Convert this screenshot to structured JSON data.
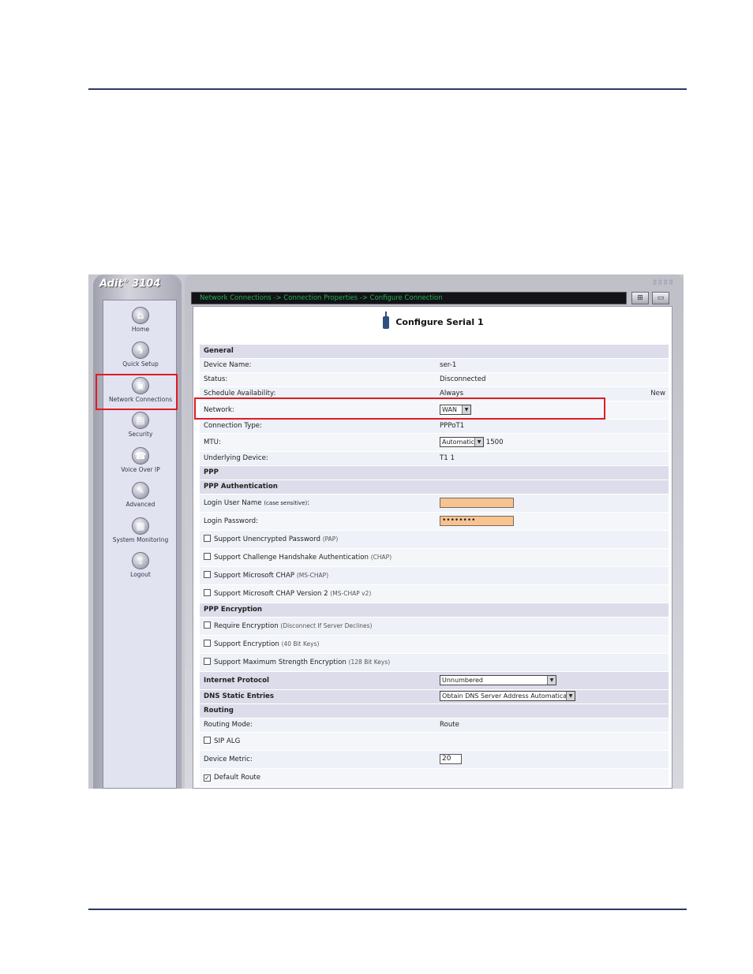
{
  "app": {
    "logo": "Adit",
    "logo_reg": "®",
    "logo_model": " 3104"
  },
  "breadcrumb": "Network Connections -> Connection Properties -> Configure Connection",
  "nav": [
    {
      "label": "Home",
      "icon": "home-icon"
    },
    {
      "label": "Quick Setup",
      "icon": "lightning-icon"
    },
    {
      "label": "Network Connections",
      "icon": "network-icon"
    },
    {
      "label": "Security",
      "icon": "lock-icon"
    },
    {
      "label": "Voice Over IP",
      "icon": "phone-icon"
    },
    {
      "label": "Advanced",
      "icon": "tools-icon"
    },
    {
      "label": "System Monitoring",
      "icon": "monitor-icon"
    },
    {
      "label": "Logout",
      "icon": "logout-icon"
    }
  ],
  "page": {
    "title": "Configure Serial 1"
  },
  "general": {
    "header": "General",
    "device_name_label": "Device Name:",
    "device_name": "ser-1",
    "status_label": "Status:",
    "status": "Disconnected",
    "schedule_label": "Schedule Availability:",
    "schedule": "Always",
    "schedule_new": "New",
    "network_label": "Network:",
    "network": "WAN",
    "conn_type_label": "Connection Type:",
    "conn_type": "PPPoT1",
    "mtu_label": "MTU:",
    "mtu_mode": "Automatic",
    "mtu_value": "1500",
    "underlying_label": "Underlying Device:",
    "underlying": "T1 1"
  },
  "ppp": {
    "header": "PPP",
    "auth_header": "PPP Authentication",
    "login_user_label": "Login User Name",
    "login_user_hint": "(case sensitive)",
    "login_user_colon": ":",
    "login_user_value": "",
    "login_pass_label": "Login Password:",
    "login_pass_value": "••••••••",
    "pap_label": "Support Unencrypted Password",
    "pap_hint": "(PAP)",
    "chap_label": "Support Challenge Handshake Authentication",
    "chap_hint": "(CHAP)",
    "mschap_label": "Support Microsoft CHAP",
    "mschap_hint": "(MS-CHAP)",
    "mschap2_label": "Support Microsoft CHAP Version 2",
    "mschap2_hint": "(MS-CHAP v2)",
    "enc_header": "PPP Encryption",
    "req_enc_label": "Require Encryption",
    "req_enc_hint": "(Disconnect If Server Declines)",
    "sup_enc_label": "Support Encryption",
    "sup_enc_hint": "(40 Bit Keys)",
    "max_enc_label": "Support Maximum Strength Encryption",
    "max_enc_hint": "(128 Bit Keys)"
  },
  "ip": {
    "internet_protocol_label": "Internet Protocol",
    "internet_protocol": "Unnumbered",
    "dns_label": "DNS Static Entries",
    "dns": "Obtain DNS Server Address Automatically"
  },
  "routing": {
    "header": "Routing",
    "mode_label": "Routing Mode:",
    "mode": "Route",
    "sip_alg_label": "SIP ALG",
    "metric_label": "Device Metric:",
    "metric": "20",
    "default_route_label": "Default Route",
    "default_route_check": "✓"
  },
  "checks": {
    "pap": false,
    "chap": false,
    "mschap": false,
    "mschap2": false,
    "req_enc": false,
    "sup_enc": false,
    "max_enc": false,
    "sip_alg": false,
    "default_route": true
  },
  "colors": {
    "highlight": "#e01b24",
    "breadcrumb": "#29b24c",
    "input_fill": "#f7c390"
  }
}
